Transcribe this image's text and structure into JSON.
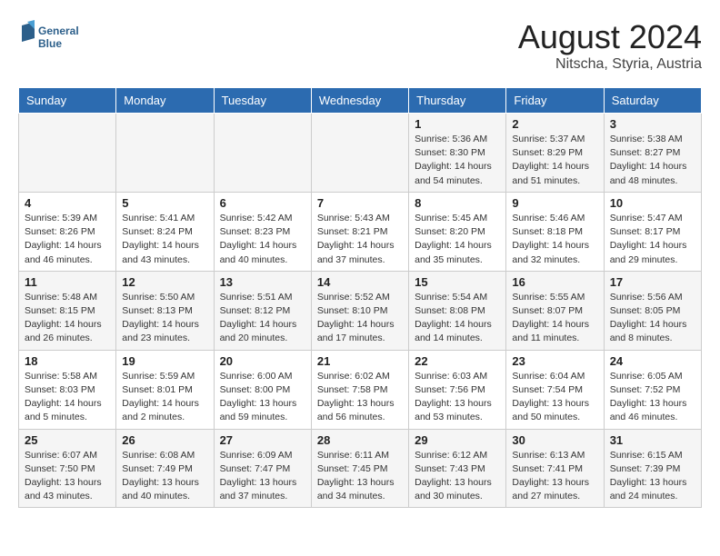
{
  "header": {
    "logo_line1": "General",
    "logo_line2": "Blue",
    "month_year": "August 2024",
    "location": "Nitscha, Styria, Austria"
  },
  "weekdays": [
    "Sunday",
    "Monday",
    "Tuesday",
    "Wednesday",
    "Thursday",
    "Friday",
    "Saturday"
  ],
  "weeks": [
    [
      {
        "day": "",
        "info": ""
      },
      {
        "day": "",
        "info": ""
      },
      {
        "day": "",
        "info": ""
      },
      {
        "day": "",
        "info": ""
      },
      {
        "day": "1",
        "info": "Sunrise: 5:36 AM\nSunset: 8:30 PM\nDaylight: 14 hours\nand 54 minutes."
      },
      {
        "day": "2",
        "info": "Sunrise: 5:37 AM\nSunset: 8:29 PM\nDaylight: 14 hours\nand 51 minutes."
      },
      {
        "day": "3",
        "info": "Sunrise: 5:38 AM\nSunset: 8:27 PM\nDaylight: 14 hours\nand 48 minutes."
      }
    ],
    [
      {
        "day": "4",
        "info": "Sunrise: 5:39 AM\nSunset: 8:26 PM\nDaylight: 14 hours\nand 46 minutes."
      },
      {
        "day": "5",
        "info": "Sunrise: 5:41 AM\nSunset: 8:24 PM\nDaylight: 14 hours\nand 43 minutes."
      },
      {
        "day": "6",
        "info": "Sunrise: 5:42 AM\nSunset: 8:23 PM\nDaylight: 14 hours\nand 40 minutes."
      },
      {
        "day": "7",
        "info": "Sunrise: 5:43 AM\nSunset: 8:21 PM\nDaylight: 14 hours\nand 37 minutes."
      },
      {
        "day": "8",
        "info": "Sunrise: 5:45 AM\nSunset: 8:20 PM\nDaylight: 14 hours\nand 35 minutes."
      },
      {
        "day": "9",
        "info": "Sunrise: 5:46 AM\nSunset: 8:18 PM\nDaylight: 14 hours\nand 32 minutes."
      },
      {
        "day": "10",
        "info": "Sunrise: 5:47 AM\nSunset: 8:17 PM\nDaylight: 14 hours\nand 29 minutes."
      }
    ],
    [
      {
        "day": "11",
        "info": "Sunrise: 5:48 AM\nSunset: 8:15 PM\nDaylight: 14 hours\nand 26 minutes."
      },
      {
        "day": "12",
        "info": "Sunrise: 5:50 AM\nSunset: 8:13 PM\nDaylight: 14 hours\nand 23 minutes."
      },
      {
        "day": "13",
        "info": "Sunrise: 5:51 AM\nSunset: 8:12 PM\nDaylight: 14 hours\nand 20 minutes."
      },
      {
        "day": "14",
        "info": "Sunrise: 5:52 AM\nSunset: 8:10 PM\nDaylight: 14 hours\nand 17 minutes."
      },
      {
        "day": "15",
        "info": "Sunrise: 5:54 AM\nSunset: 8:08 PM\nDaylight: 14 hours\nand 14 minutes."
      },
      {
        "day": "16",
        "info": "Sunrise: 5:55 AM\nSunset: 8:07 PM\nDaylight: 14 hours\nand 11 minutes."
      },
      {
        "day": "17",
        "info": "Sunrise: 5:56 AM\nSunset: 8:05 PM\nDaylight: 14 hours\nand 8 minutes."
      }
    ],
    [
      {
        "day": "18",
        "info": "Sunrise: 5:58 AM\nSunset: 8:03 PM\nDaylight: 14 hours\nand 5 minutes."
      },
      {
        "day": "19",
        "info": "Sunrise: 5:59 AM\nSunset: 8:01 PM\nDaylight: 14 hours\nand 2 minutes."
      },
      {
        "day": "20",
        "info": "Sunrise: 6:00 AM\nSunset: 8:00 PM\nDaylight: 13 hours\nand 59 minutes."
      },
      {
        "day": "21",
        "info": "Sunrise: 6:02 AM\nSunset: 7:58 PM\nDaylight: 13 hours\nand 56 minutes."
      },
      {
        "day": "22",
        "info": "Sunrise: 6:03 AM\nSunset: 7:56 PM\nDaylight: 13 hours\nand 53 minutes."
      },
      {
        "day": "23",
        "info": "Sunrise: 6:04 AM\nSunset: 7:54 PM\nDaylight: 13 hours\nand 50 minutes."
      },
      {
        "day": "24",
        "info": "Sunrise: 6:05 AM\nSunset: 7:52 PM\nDaylight: 13 hours\nand 46 minutes."
      }
    ],
    [
      {
        "day": "25",
        "info": "Sunrise: 6:07 AM\nSunset: 7:50 PM\nDaylight: 13 hours\nand 43 minutes."
      },
      {
        "day": "26",
        "info": "Sunrise: 6:08 AM\nSunset: 7:49 PM\nDaylight: 13 hours\nand 40 minutes."
      },
      {
        "day": "27",
        "info": "Sunrise: 6:09 AM\nSunset: 7:47 PM\nDaylight: 13 hours\nand 37 minutes."
      },
      {
        "day": "28",
        "info": "Sunrise: 6:11 AM\nSunset: 7:45 PM\nDaylight: 13 hours\nand 34 minutes."
      },
      {
        "day": "29",
        "info": "Sunrise: 6:12 AM\nSunset: 7:43 PM\nDaylight: 13 hours\nand 30 minutes."
      },
      {
        "day": "30",
        "info": "Sunrise: 6:13 AM\nSunset: 7:41 PM\nDaylight: 13 hours\nand 27 minutes."
      },
      {
        "day": "31",
        "info": "Sunrise: 6:15 AM\nSunset: 7:39 PM\nDaylight: 13 hours\nand 24 minutes."
      }
    ]
  ]
}
